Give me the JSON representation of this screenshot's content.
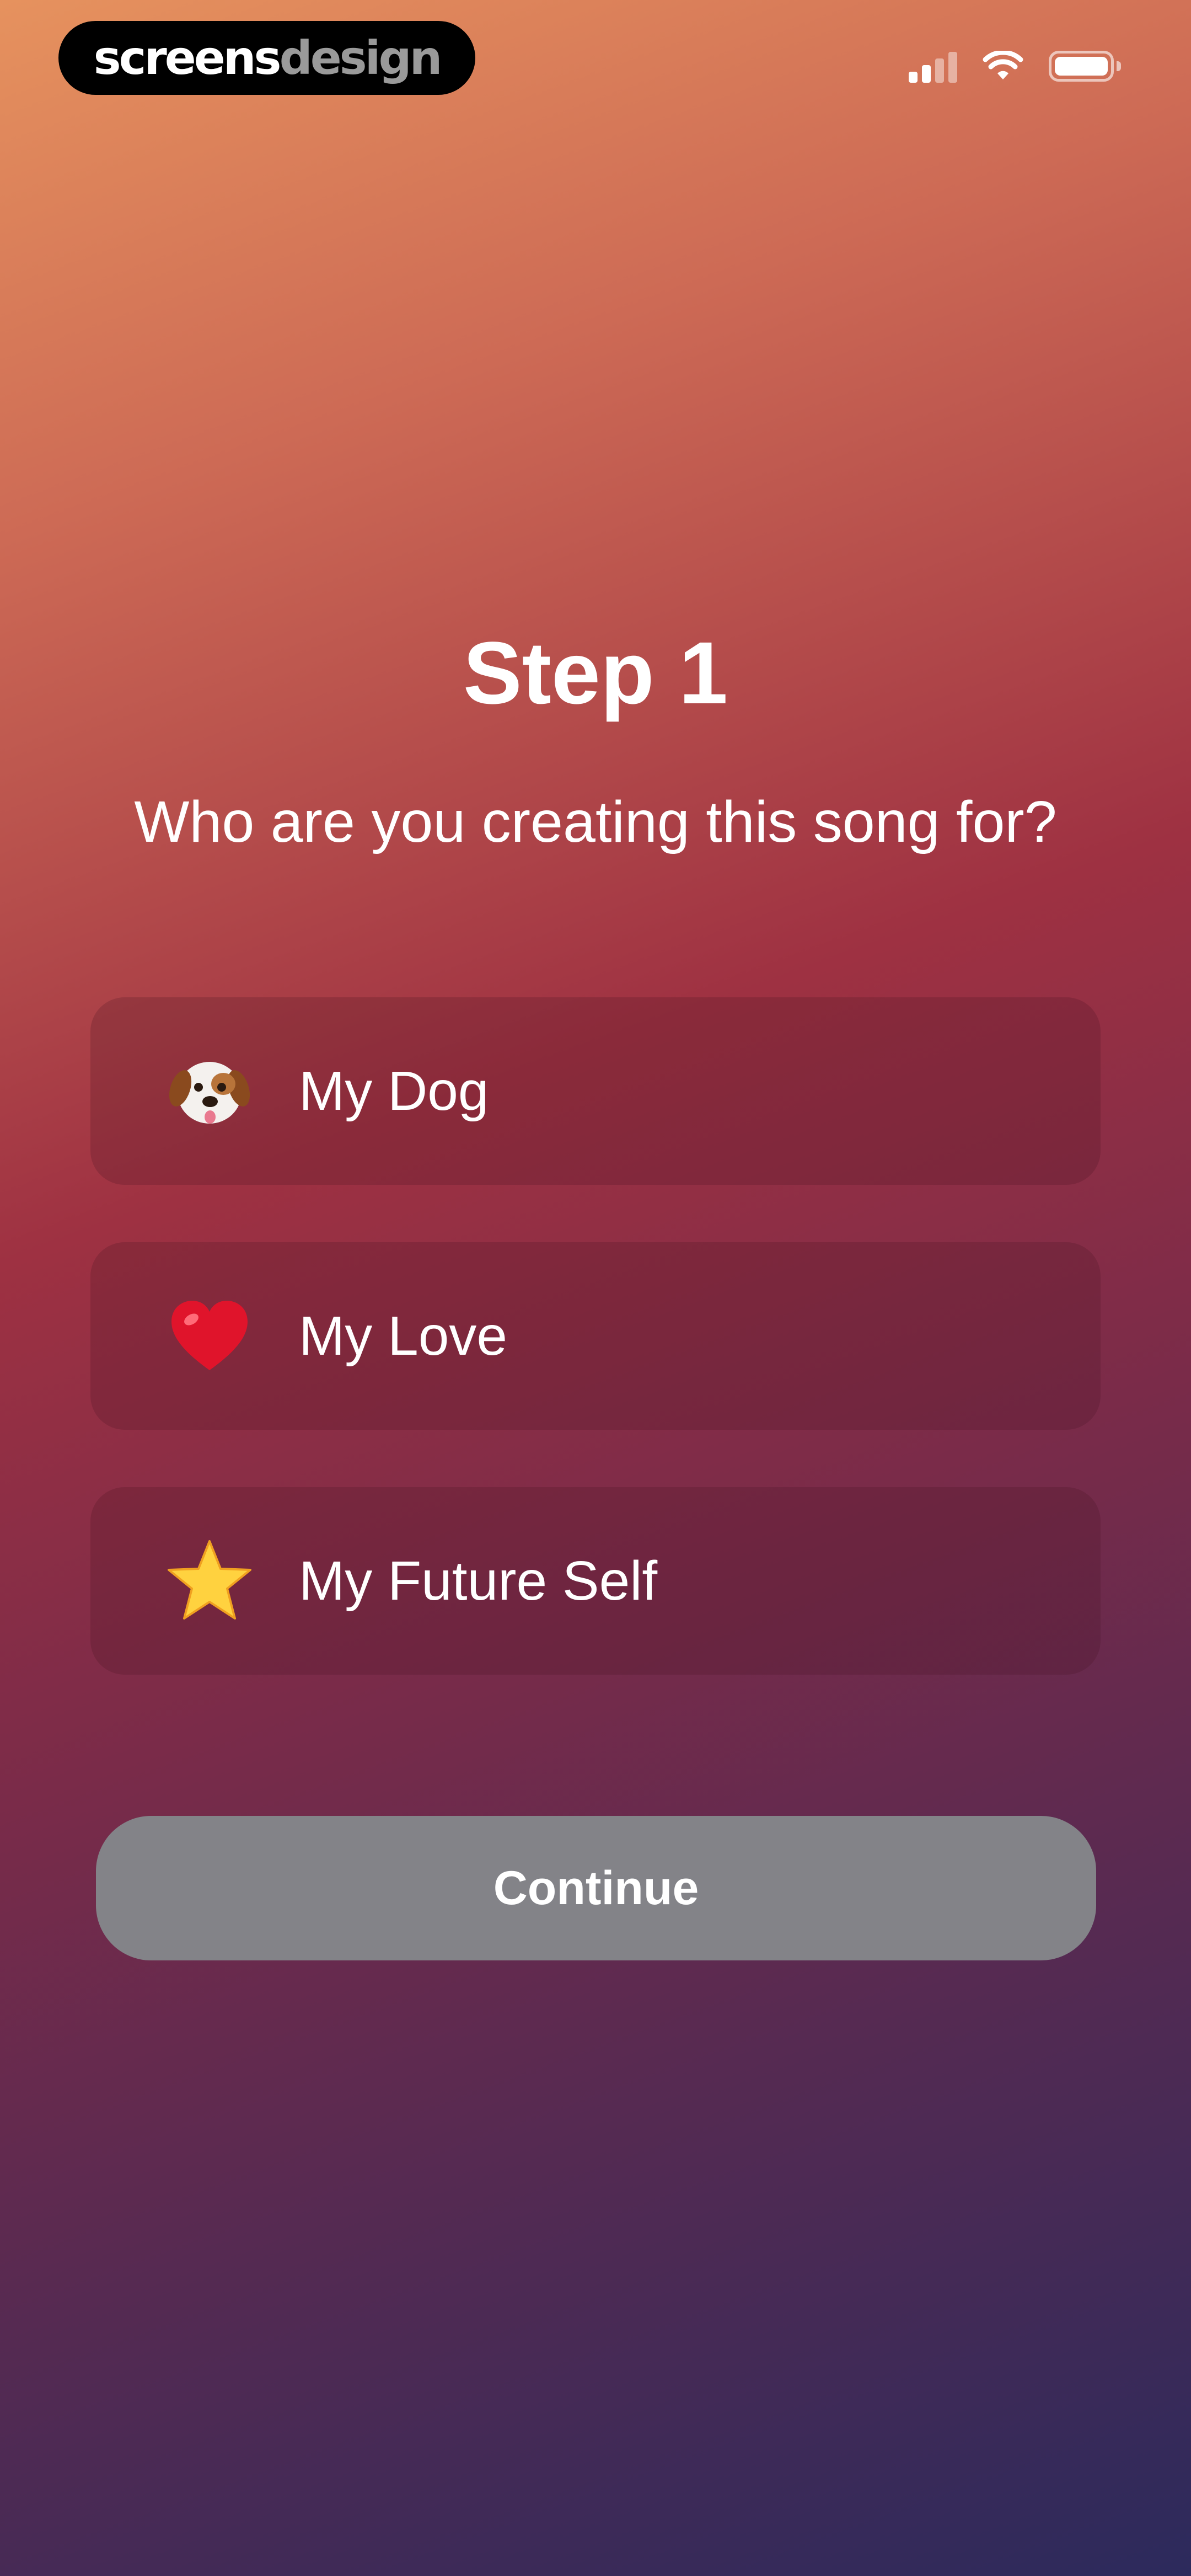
{
  "watermark": {
    "part1": "screens",
    "part2": "design"
  },
  "status_bar": {
    "icons": [
      "cellular-signal-icon",
      "wifi-icon",
      "battery-icon"
    ]
  },
  "header": {
    "title": "Step 1",
    "subtitle": "Who are you creating this song for?"
  },
  "options": [
    {
      "label": "My Dog",
      "icon": "dog-face-icon"
    },
    {
      "label": "My Love",
      "icon": "red-heart-icon"
    },
    {
      "label": "My Future Self",
      "icon": "star-icon"
    }
  ],
  "continue_button": {
    "label": "Continue"
  },
  "colors": {
    "button_background": "#838388",
    "option_background": "rgba(70,20,30,0.22)",
    "text": "#ffffff",
    "gradient_top": "#e6925e",
    "gradient_bottom": "#2c2a5c"
  }
}
